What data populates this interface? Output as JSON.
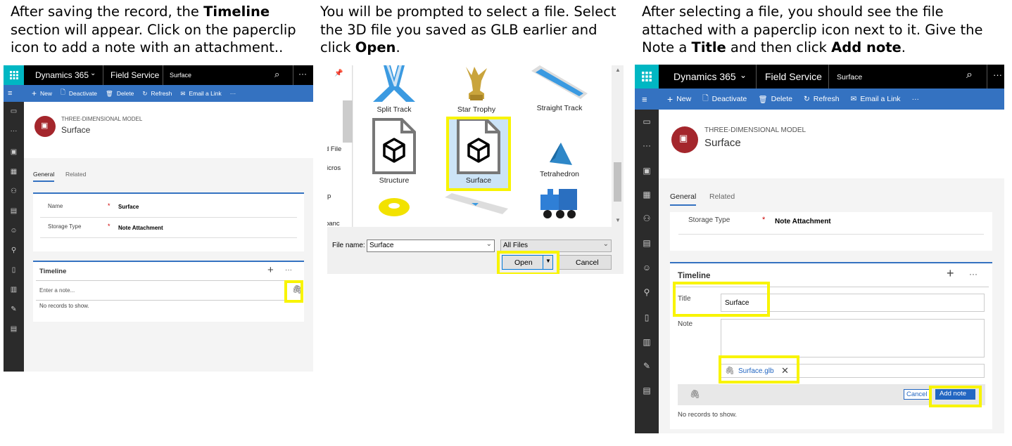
{
  "instructions": {
    "step1": {
      "pre": "After saving the record, the ",
      "bold": "Timeline",
      "post": " section will appear. Click on the paperclip icon to add a note with an attachment.."
    },
    "step2": {
      "pre": "You will be prompted to select a file. Select the 3D file you saved as GLB earlier and click ",
      "bold": "Open",
      "post": "."
    },
    "step3": {
      "pre": "After selecting a file, you should see the file attached with a paperclip icon next to it. Give the Note a ",
      "bold1": "Title",
      "mid": " and then click ",
      "bold2": "Add note",
      "post": "."
    }
  },
  "crm": {
    "app_name": "Dynamics 365",
    "module": "Field Service",
    "record_tab": "Surface",
    "commands": {
      "new": "New",
      "deactivate": "Deactivate",
      "delete": "Delete",
      "refresh": "Refresh",
      "email_link": "Email a Link",
      "more": "···"
    },
    "entity_type": "THREE-DIMENSIONAL MODEL",
    "record_name": "Surface",
    "tabs": {
      "general": "General",
      "related": "Related"
    },
    "fields": {
      "name_label": "Name",
      "name_value": "Surface",
      "storage_label": "Storage Type",
      "storage_value": "Note Attachment",
      "required_mark": "*"
    },
    "timeline": {
      "title": "Timeline",
      "note_placeholder": "Enter a note...",
      "no_records": "No records to show.",
      "title_label": "Title",
      "title_value": "Surface",
      "note_label": "Note",
      "attachment": "Surface.glb",
      "cancel": "Cancel",
      "add_note": "Add note"
    }
  },
  "file_dialog": {
    "files_row1": [
      "Split Track",
      "Star Trophy",
      "Straight Track"
    ],
    "files_row2": [
      "Structure",
      "Surface",
      "Tetrahedron"
    ],
    "left_pane_fragments": [
      "d File",
      "licros",
      "p",
      "panc"
    ],
    "file_name_label": "File name:",
    "file_name_value": "Surface",
    "file_type": "All Files",
    "open": "Open",
    "cancel": "Cancel"
  },
  "colors": {
    "highlight": "#f8f400",
    "command_bar": "#3472c1",
    "accent_teal": "#00b7c3",
    "record_icon": "#a4262c",
    "link_blue": "#2266c2"
  }
}
